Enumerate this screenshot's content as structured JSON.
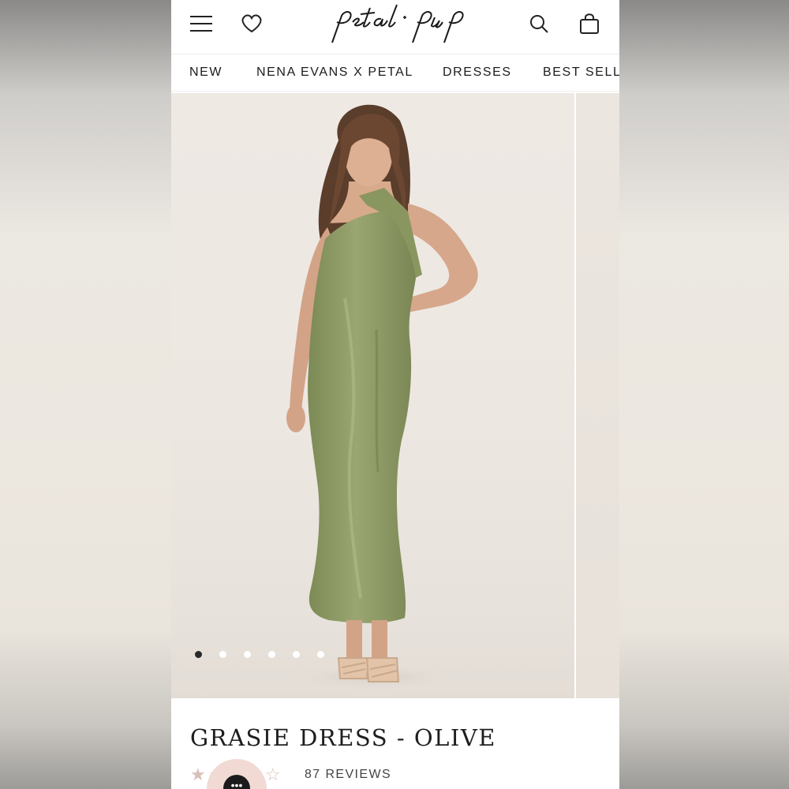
{
  "brand": {
    "logo_text": "petal + pup"
  },
  "header": {
    "menu_icon": "menu-icon",
    "wishlist_icon": "heart-icon",
    "search_icon": "search-icon",
    "cart_icon": "shopping-bag-icon"
  },
  "nav": {
    "items": [
      {
        "label": "NEW"
      },
      {
        "label": "NENA EVANS X PETAL"
      },
      {
        "label": "DRESSES"
      },
      {
        "label": "BEST SELLI"
      }
    ]
  },
  "gallery": {
    "image_alt": "Model wearing olive satin halter maxi dress",
    "dots": 6,
    "active_dot": 0
  },
  "product": {
    "title": "GRASIE DRESS - OLIVE",
    "rating": 4.5,
    "reviews_label": "87 REVIEWS"
  },
  "colors": {
    "dress": "#8e9a66",
    "star": "#d8bfb8",
    "chat_bubble": "#f1d9d4"
  }
}
